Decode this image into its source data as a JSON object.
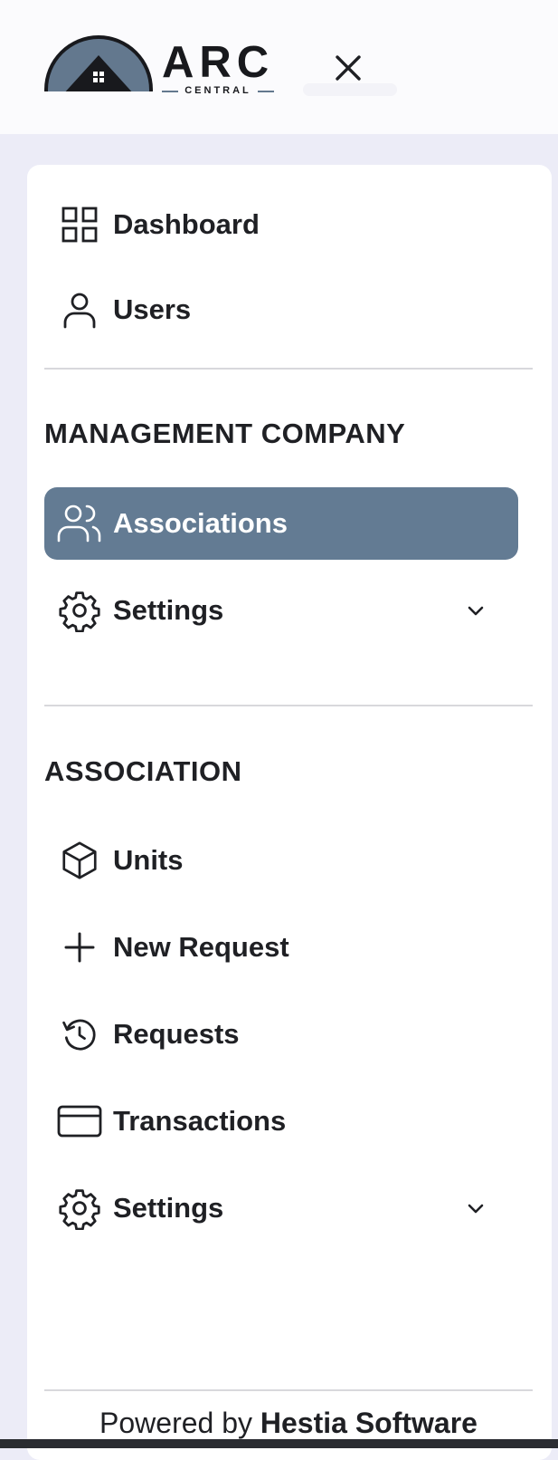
{
  "header": {
    "logo_text": "ARC",
    "logo_subtext": "CENTRAL",
    "close_icon": "close-icon"
  },
  "nav": {
    "top_items": [
      {
        "label": "Dashboard",
        "icon": "grid-icon"
      },
      {
        "label": "Users",
        "icon": "user-icon"
      }
    ],
    "management_section": {
      "heading": "MANAGEMENT COMPANY",
      "items": [
        {
          "label": "Associations",
          "icon": "users-icon",
          "active": true
        },
        {
          "label": "Settings",
          "icon": "gear-icon",
          "expandable": true
        }
      ]
    },
    "association_section": {
      "heading": "ASSOCIATION",
      "items": [
        {
          "label": "Units",
          "icon": "cube-icon"
        },
        {
          "label": "New Request",
          "icon": "plus-icon"
        },
        {
          "label": "Requests",
          "icon": "history-icon"
        },
        {
          "label": "Transactions",
          "icon": "credit-card-icon"
        },
        {
          "label": "Settings",
          "icon": "gear-icon",
          "expandable": true
        }
      ]
    }
  },
  "footer": {
    "prefix": "Powered by",
    "brand": "Hestia Software"
  },
  "colors": {
    "active_bg": "#637b93",
    "page_bg": "#ececf7",
    "panel_bg": "#ffffff",
    "text": "#1f2024"
  }
}
